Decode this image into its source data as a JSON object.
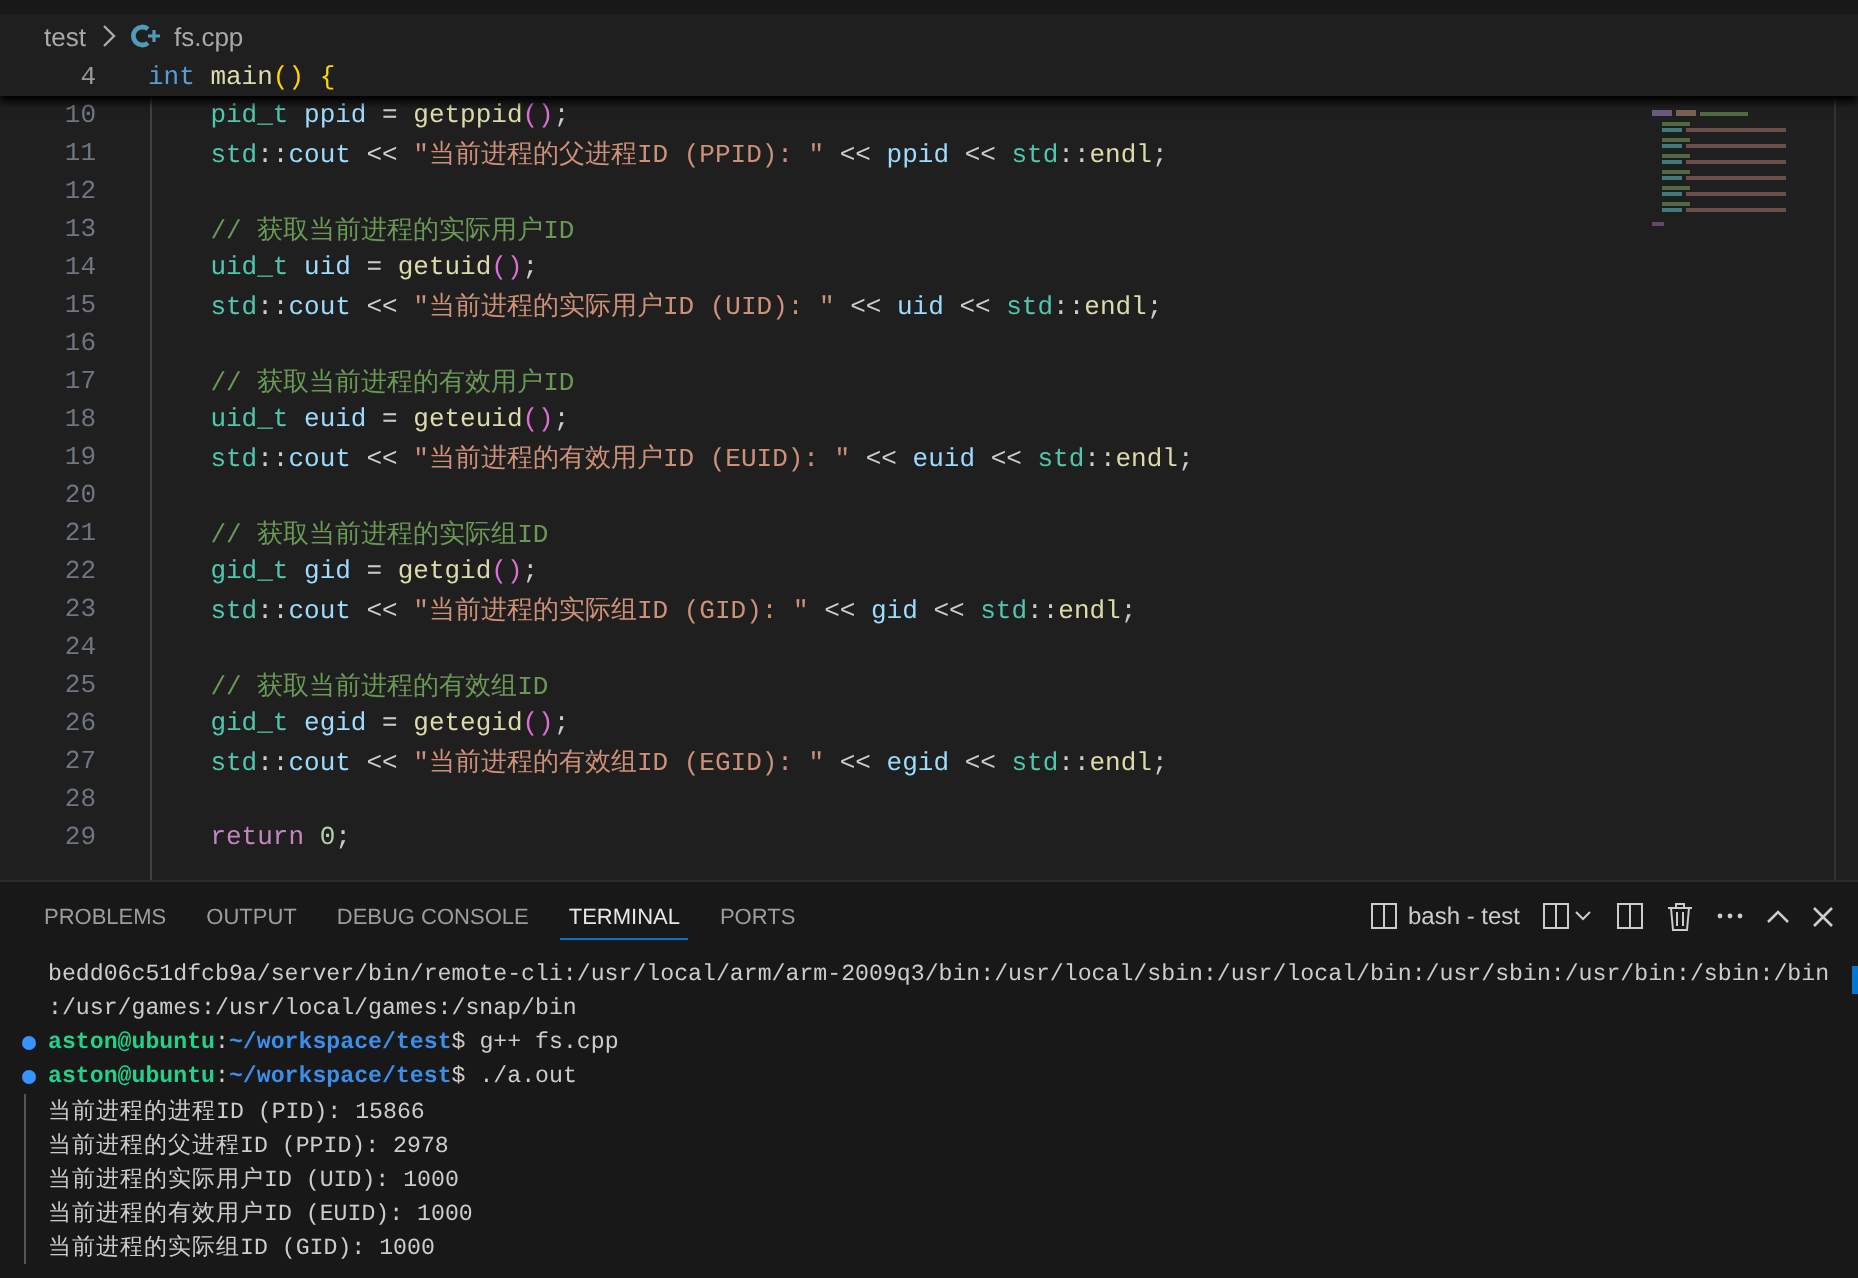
{
  "breadcrumb": {
    "folder": "test",
    "file": "fs.cpp"
  },
  "sticky_line": {
    "number": "4",
    "tokens": [
      {
        "kind": "keyword",
        "text": "int"
      },
      {
        "kind": "func",
        "text": " main"
      },
      {
        "kind": "bracket1",
        "text": "()"
      },
      {
        "kind": "bracket1",
        "text": " {"
      }
    ]
  },
  "code_lines": [
    {
      "number": "10",
      "indented": true,
      "tokens": [
        {
          "kind": "type",
          "text": "pid_t"
        },
        {
          "kind": "variable",
          "text": " ppid"
        },
        {
          "kind": "plain",
          "text": " = "
        },
        {
          "kind": "func",
          "text": "getppid"
        },
        {
          "kind": "bracket2",
          "text": "()"
        },
        {
          "kind": "plain",
          "text": ";"
        }
      ]
    },
    {
      "number": "11",
      "indented": true,
      "tokens": [
        {
          "kind": "type",
          "text": "std"
        },
        {
          "kind": "plain",
          "text": "::"
        },
        {
          "kind": "variable",
          "text": "cout"
        },
        {
          "kind": "plain",
          "text": " << "
        },
        {
          "kind": "string",
          "text": "\"当前进程的父进程ID (PPID): \""
        },
        {
          "kind": "plain",
          "text": " << "
        },
        {
          "kind": "variable",
          "text": "ppid"
        },
        {
          "kind": "plain",
          "text": " << "
        },
        {
          "kind": "type",
          "text": "std"
        },
        {
          "kind": "plain",
          "text": "::"
        },
        {
          "kind": "func",
          "text": "endl"
        },
        {
          "kind": "plain",
          "text": ";"
        }
      ]
    },
    {
      "number": "12"
    },
    {
      "number": "13",
      "indented": true,
      "tokens": [
        {
          "kind": "comment",
          "text": "// 获取当前进程的实际用户ID"
        }
      ]
    },
    {
      "number": "14",
      "indented": true,
      "tokens": [
        {
          "kind": "type",
          "text": "uid_t"
        },
        {
          "kind": "variable",
          "text": " uid"
        },
        {
          "kind": "plain",
          "text": " = "
        },
        {
          "kind": "func",
          "text": "getuid"
        },
        {
          "kind": "bracket2",
          "text": "()"
        },
        {
          "kind": "plain",
          "text": ";"
        }
      ]
    },
    {
      "number": "15",
      "indented": true,
      "tokens": [
        {
          "kind": "type",
          "text": "std"
        },
        {
          "kind": "plain",
          "text": "::"
        },
        {
          "kind": "variable",
          "text": "cout"
        },
        {
          "kind": "plain",
          "text": " << "
        },
        {
          "kind": "string",
          "text": "\"当前进程的实际用户ID (UID): \""
        },
        {
          "kind": "plain",
          "text": " << "
        },
        {
          "kind": "variable",
          "text": "uid"
        },
        {
          "kind": "plain",
          "text": " << "
        },
        {
          "kind": "type",
          "text": "std"
        },
        {
          "kind": "plain",
          "text": "::"
        },
        {
          "kind": "func",
          "text": "endl"
        },
        {
          "kind": "plain",
          "text": ";"
        }
      ]
    },
    {
      "number": "16"
    },
    {
      "number": "17",
      "indented": true,
      "tokens": [
        {
          "kind": "comment",
          "text": "// 获取当前进程的有效用户ID"
        }
      ]
    },
    {
      "number": "18",
      "indented": true,
      "tokens": [
        {
          "kind": "type",
          "text": "uid_t"
        },
        {
          "kind": "variable",
          "text": " euid"
        },
        {
          "kind": "plain",
          "text": " = "
        },
        {
          "kind": "func",
          "text": "geteuid"
        },
        {
          "kind": "bracket2",
          "text": "()"
        },
        {
          "kind": "plain",
          "text": ";"
        }
      ]
    },
    {
      "number": "19",
      "indented": true,
      "tokens": [
        {
          "kind": "type",
          "text": "std"
        },
        {
          "kind": "plain",
          "text": "::"
        },
        {
          "kind": "variable",
          "text": "cout"
        },
        {
          "kind": "plain",
          "text": " << "
        },
        {
          "kind": "string",
          "text": "\"当前进程的有效用户ID (EUID): \""
        },
        {
          "kind": "plain",
          "text": " << "
        },
        {
          "kind": "variable",
          "text": "euid"
        },
        {
          "kind": "plain",
          "text": " << "
        },
        {
          "kind": "type",
          "text": "std"
        },
        {
          "kind": "plain",
          "text": "::"
        },
        {
          "kind": "func",
          "text": "endl"
        },
        {
          "kind": "plain",
          "text": ";"
        }
      ]
    },
    {
      "number": "20"
    },
    {
      "number": "21",
      "indented": true,
      "tokens": [
        {
          "kind": "comment",
          "text": "// 获取当前进程的实际组ID"
        }
      ]
    },
    {
      "number": "22",
      "indented": true,
      "tokens": [
        {
          "kind": "type",
          "text": "gid_t"
        },
        {
          "kind": "variable",
          "text": " gid"
        },
        {
          "kind": "plain",
          "text": " = "
        },
        {
          "kind": "func",
          "text": "getgid"
        },
        {
          "kind": "bracket2",
          "text": "()"
        },
        {
          "kind": "plain",
          "text": ";"
        }
      ]
    },
    {
      "number": "23",
      "indented": true,
      "tokens": [
        {
          "kind": "type",
          "text": "std"
        },
        {
          "kind": "plain",
          "text": "::"
        },
        {
          "kind": "variable",
          "text": "cout"
        },
        {
          "kind": "plain",
          "text": " << "
        },
        {
          "kind": "string",
          "text": "\"当前进程的实际组ID (GID): \""
        },
        {
          "kind": "plain",
          "text": " << "
        },
        {
          "kind": "variable",
          "text": "gid"
        },
        {
          "kind": "plain",
          "text": " << "
        },
        {
          "kind": "type",
          "text": "std"
        },
        {
          "kind": "plain",
          "text": "::"
        },
        {
          "kind": "func",
          "text": "endl"
        },
        {
          "kind": "plain",
          "text": ";"
        }
      ]
    },
    {
      "number": "24"
    },
    {
      "number": "25",
      "indented": true,
      "tokens": [
        {
          "kind": "comment",
          "text": "// 获取当前进程的有效组ID"
        }
      ]
    },
    {
      "number": "26",
      "indented": true,
      "tokens": [
        {
          "kind": "type",
          "text": "gid_t"
        },
        {
          "kind": "variable",
          "text": " egid"
        },
        {
          "kind": "plain",
          "text": " = "
        },
        {
          "kind": "func",
          "text": "getegid"
        },
        {
          "kind": "bracket2",
          "text": "()"
        },
        {
          "kind": "plain",
          "text": ";"
        }
      ]
    },
    {
      "number": "27",
      "indented": true,
      "tokens": [
        {
          "kind": "type",
          "text": "std"
        },
        {
          "kind": "plain",
          "text": "::"
        },
        {
          "kind": "variable",
          "text": "cout"
        },
        {
          "kind": "plain",
          "text": " << "
        },
        {
          "kind": "string",
          "text": "\"当前进程的有效组ID (EGID): \""
        },
        {
          "kind": "plain",
          "text": " << "
        },
        {
          "kind": "variable",
          "text": "egid"
        },
        {
          "kind": "plain",
          "text": " << "
        },
        {
          "kind": "type",
          "text": "std"
        },
        {
          "kind": "plain",
          "text": "::"
        },
        {
          "kind": "func",
          "text": "endl"
        },
        {
          "kind": "plain",
          "text": ";"
        }
      ]
    },
    {
      "number": "28"
    },
    {
      "number": "29",
      "indented": true,
      "tokens": [
        {
          "kind": "control",
          "text": "return"
        },
        {
          "kind": "number",
          "text": " 0"
        },
        {
          "kind": "plain",
          "text": ";"
        }
      ]
    }
  ],
  "panel_tabs": [
    {
      "label": "PROBLEMS",
      "selected": false
    },
    {
      "label": "OUTPUT",
      "selected": false
    },
    {
      "label": "DEBUG CONSOLE",
      "selected": false
    },
    {
      "label": "TERMINAL",
      "selected": true
    },
    {
      "label": "PORTS",
      "selected": false
    }
  ],
  "terminal_name": "bash - test",
  "terminal_lines": [
    {
      "kind": "output",
      "text": "bedd06c51dfcb9a/server/bin/remote-cli:/usr/local/arm/arm-2009q3/bin:/usr/local/sbin:/usr/local/bin:/usr/sbin:/usr/bin:/sbin:/bin"
    },
    {
      "kind": "output",
      "text": ":/usr/games:/usr/local/games:/snap/bin"
    },
    {
      "kind": "prompt",
      "user": "aston@ubuntu",
      "sep": ":",
      "path": "~/workspace/test",
      "command": "$ g++ fs.cpp"
    },
    {
      "kind": "prompt",
      "user": "aston@ubuntu",
      "sep": ":",
      "path": "~/workspace/test",
      "command": "$ ./a.out"
    },
    {
      "kind": "result",
      "text": "当前进程的进程ID (PID): 15866"
    },
    {
      "kind": "result",
      "text": "当前进程的父进程ID (PPID): 2978"
    },
    {
      "kind": "result",
      "text": "当前进程的实际用户ID (UID): 1000"
    },
    {
      "kind": "result",
      "text": "当前进程的有效用户ID (EUID): 1000"
    },
    {
      "kind": "result",
      "text": "当前进程的实际组ID (GID): 1000"
    }
  ]
}
